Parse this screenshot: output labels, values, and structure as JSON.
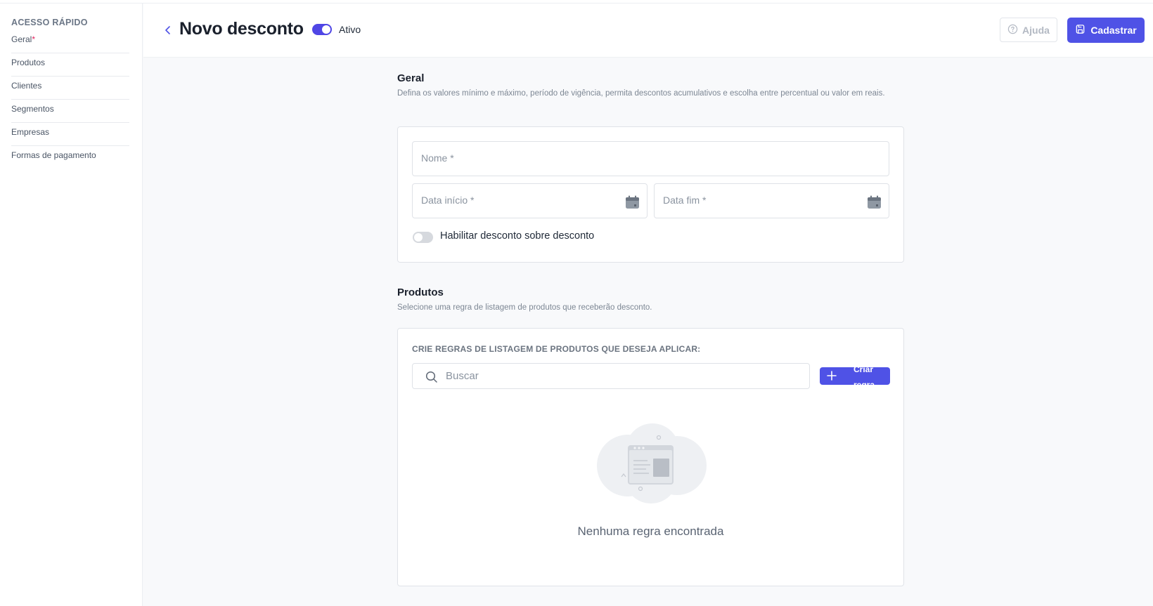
{
  "sidebar": {
    "heading": "ACESSO RÁPIDO",
    "items": [
      {
        "label": "Geral",
        "required_mark": "*"
      },
      {
        "label": "Produtos"
      },
      {
        "label": "Clientes"
      },
      {
        "label": "Segmentos"
      },
      {
        "label": "Empresas"
      },
      {
        "label": "Formas de pagamento"
      }
    ]
  },
  "header": {
    "title": "Novo desconto",
    "status_label": "Ativo",
    "status_on": true,
    "help_label": "Ajuda",
    "submit_label": "Cadastrar",
    "accent": "#4f52e6"
  },
  "general": {
    "title": "Geral",
    "description": "Defina os valores mínimo e máximo, período de vigência, permita descontos acumulativos e escolha entre percentual ou valor em reais.",
    "name_placeholder": "Nome *",
    "start_placeholder": "Data início *",
    "end_placeholder": "Data fim *",
    "stack_toggle_label": "Habilitar desconto sobre desconto",
    "stack_toggle_on": false
  },
  "products": {
    "title": "Produtos",
    "description": "Selecione uma regra de listagem de produtos que receberão desconto.",
    "rules_heading": "CRIE REGRAS DE LISTAGEM DE PRODUTOS QUE DESEJA APLICAR:",
    "search_placeholder": "Buscar",
    "add_rule_label": "Criar regra",
    "empty_text": "Nenhuma regra encontrada"
  }
}
